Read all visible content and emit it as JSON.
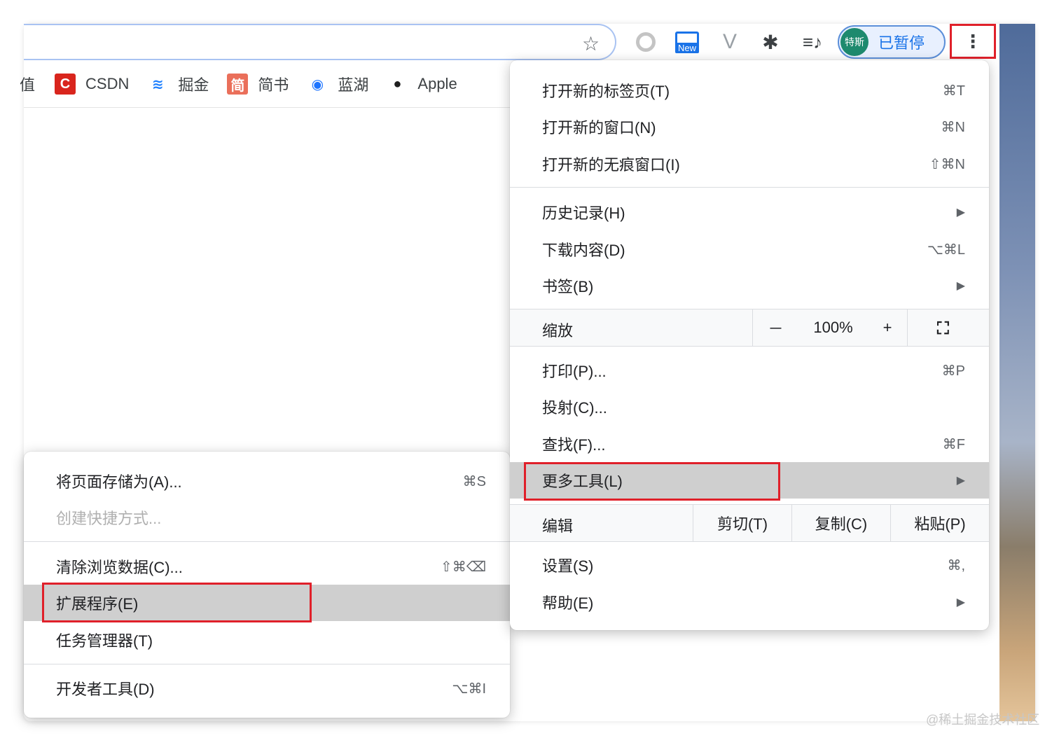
{
  "toolbar": {
    "star_icon": "star-icon",
    "extensions": [
      {
        "name": "circle-extension-icon"
      },
      {
        "name": "new-extension-icon",
        "tag": "New"
      },
      {
        "name": "vue-devtools-icon",
        "glyph": "V"
      },
      {
        "name": "puzzle-icon"
      },
      {
        "name": "media-queue-icon"
      }
    ],
    "profile_avatar": "特斯",
    "profile_label": "已暂停",
    "menu_icon": "kebab-menu-icon"
  },
  "bookmarks": [
    {
      "label": "值",
      "icon": "none"
    },
    {
      "label": "CSDN",
      "icon": "csdn-icon",
      "glyph": "C"
    },
    {
      "label": "掘金",
      "icon": "juejin-icon",
      "glyph": "≋"
    },
    {
      "label": "简书",
      "icon": "jianshu-icon",
      "glyph": "简"
    },
    {
      "label": "蓝湖",
      "icon": "lanhu-icon",
      "glyph": "◉"
    },
    {
      "label": "Apple",
      "icon": "apple-icon",
      "glyph": ""
    }
  ],
  "main_menu": {
    "new_tab": {
      "label": "打开新的标签页(T)",
      "shortcut": "⌘T"
    },
    "new_window": {
      "label": "打开新的窗口(N)",
      "shortcut": "⌘N"
    },
    "incognito": {
      "label": "打开新的无痕窗口(I)",
      "shortcut": "⇧⌘N"
    },
    "history": {
      "label": "历史记录(H)"
    },
    "downloads": {
      "label": "下载内容(D)",
      "shortcut": "⌥⌘L"
    },
    "bookmarks": {
      "label": "书签(B)"
    },
    "zoom": {
      "label": "缩放",
      "minus": "－",
      "value": "100%",
      "plus": "+"
    },
    "print": {
      "label": "打印(P)...",
      "shortcut": "⌘P"
    },
    "cast": {
      "label": "投射(C)..."
    },
    "find": {
      "label": "查找(F)...",
      "shortcut": "⌘F"
    },
    "more_tools": {
      "label": "更多工具(L)"
    },
    "edit": {
      "label": "编辑",
      "cut": "剪切(T)",
      "copy": "复制(C)",
      "paste": "粘贴(P)"
    },
    "settings": {
      "label": "设置(S)",
      "shortcut": "⌘,"
    },
    "help": {
      "label": "帮助(E)"
    }
  },
  "sub_menu": {
    "save_page": {
      "label": "将页面存储为(A)...",
      "shortcut": "⌘S"
    },
    "create_shortcut": {
      "label": "创建快捷方式..."
    },
    "clear_data": {
      "label": "清除浏览数据(C)...",
      "shortcut": "⇧⌘⌫"
    },
    "extensions": {
      "label": "扩展程序(E)"
    },
    "task_manager": {
      "label": "任务管理器(T)"
    },
    "dev_tools": {
      "label": "开发者工具(D)",
      "shortcut": "⌥⌘I"
    }
  },
  "watermark": "@稀土掘金技术社区",
  "colors": {
    "highlight": "#cfcfcf",
    "annotation_red": "#e0202a",
    "accent": "#1a73e8"
  }
}
